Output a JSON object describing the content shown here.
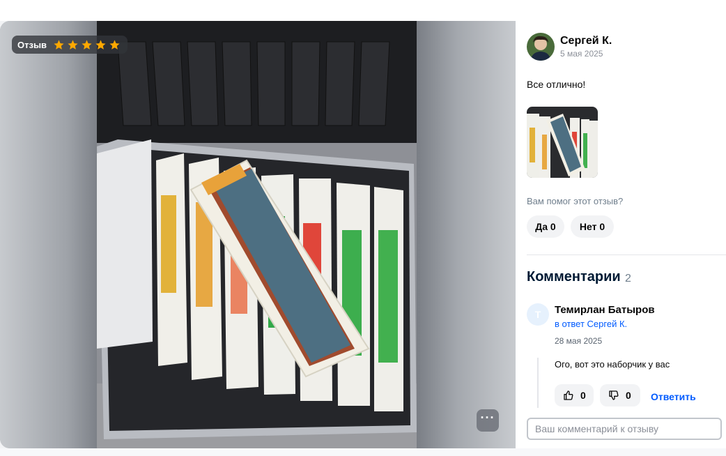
{
  "media": {
    "review_label": "Отзыв",
    "rating": 5,
    "max_rating": 5,
    "star_color": "#ffa800",
    "more_label": "···"
  },
  "review": {
    "author": "Сергей К.",
    "date": "5 мая 2025",
    "text": "Все отлично!",
    "helpful_question": "Вам помог этот отзыв?",
    "vote_yes": "Да 0",
    "vote_no": "Нет 0"
  },
  "comments": {
    "title": "Комментарии",
    "count": "2",
    "items": [
      {
        "avatar_letter": "Т",
        "author": "Темирлан Батыров",
        "reply_to": "в ответ Сергей К.",
        "date": "28 мая 2025",
        "text": "Ого, вот это наборчик у вас",
        "likes": "0",
        "dislikes": "0",
        "answer_label": "Ответить"
      }
    ],
    "input_placeholder": "Ваш комментарий к отзыву"
  },
  "colors": {
    "accent_blue": "#005bff",
    "muted_text": "#707f8d",
    "chip_bg": "#f2f3f5"
  }
}
